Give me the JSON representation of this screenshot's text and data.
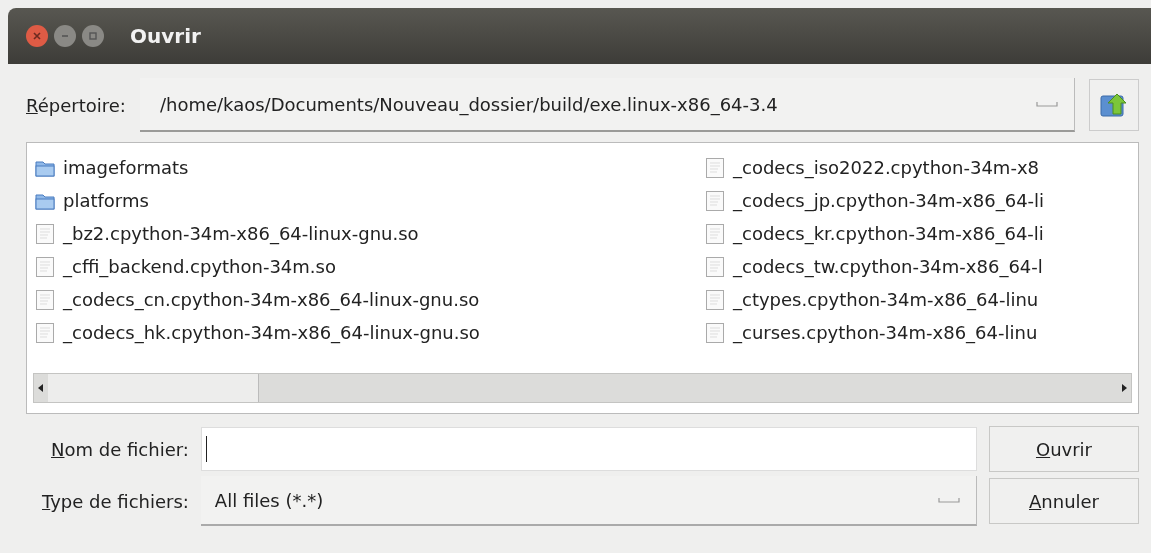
{
  "window": {
    "title": "Ouvrir"
  },
  "directory": {
    "label": "Répertoire:",
    "value": "/home/kaos/Documents/Nouveau_dossier/build/exe.linux-x86_64-3.4"
  },
  "files": [
    {
      "name": "imageformats",
      "kind": "folder"
    },
    {
      "name": "platforms",
      "kind": "folder"
    },
    {
      "name": "_bz2.cpython-34m-x86_64-linux-gnu.so",
      "kind": "file"
    },
    {
      "name": "_cffi_backend.cpython-34m.so",
      "kind": "file"
    },
    {
      "name": "_codecs_cn.cpython-34m-x86_64-linux-gnu.so",
      "kind": "file"
    },
    {
      "name": "_codecs_hk.cpython-34m-x86_64-linux-gnu.so",
      "kind": "file"
    },
    {
      "name": "_codecs_iso2022.cpython-34m-x8",
      "kind": "file"
    },
    {
      "name": "_codecs_jp.cpython-34m-x86_64-li",
      "kind": "file"
    },
    {
      "name": "_codecs_kr.cpython-34m-x86_64-li",
      "kind": "file"
    },
    {
      "name": "_codecs_tw.cpython-34m-x86_64-l",
      "kind": "file"
    },
    {
      "name": "_ctypes.cpython-34m-x86_64-linu",
      "kind": "file"
    },
    {
      "name": "_curses.cpython-34m-x86_64-linu",
      "kind": "file"
    }
  ],
  "filename": {
    "label": "Nom de fichier:"
  },
  "filetype": {
    "label": "Type de fichiers:",
    "value": "All files (*.*)"
  },
  "buttons": [
    "Ouvrir",
    "Annuler"
  ]
}
